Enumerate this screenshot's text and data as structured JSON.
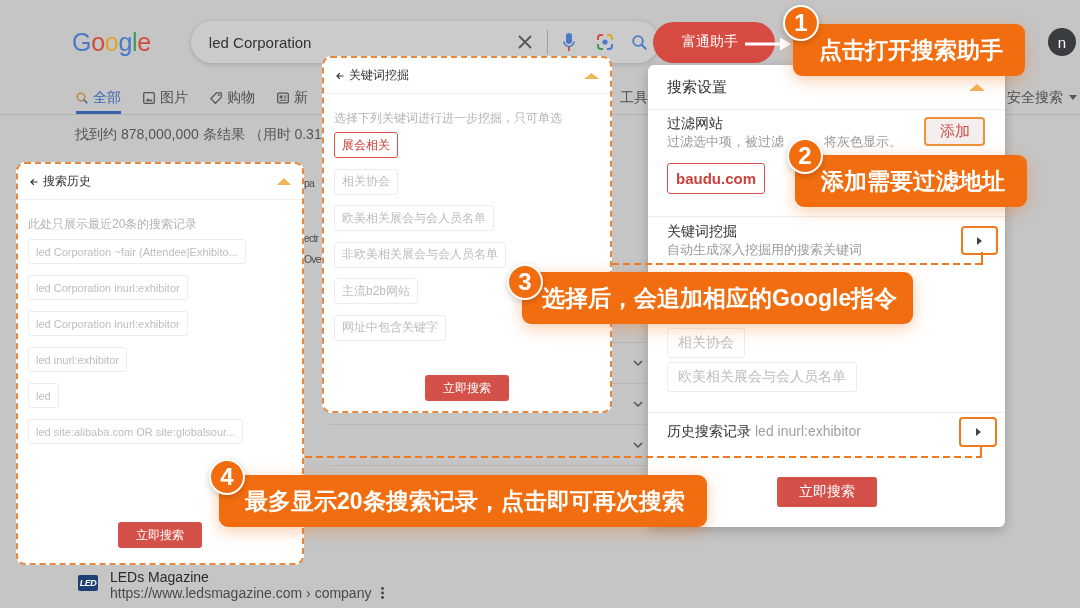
{
  "browser": {
    "logo": "Google",
    "query": "led Corporation",
    "assistant_button": "富通助手",
    "avatar": "n",
    "tabs": [
      {
        "label": "全部",
        "kind": "search",
        "selected": true
      },
      {
        "label": "图片",
        "kind": "image",
        "selected": false
      },
      {
        "label": "购物",
        "kind": "tag",
        "selected": false
      },
      {
        "label": "新",
        "kind": "news",
        "selected": false
      }
    ],
    "tools": "工具",
    "safe_search": "安全搜索",
    "result_stats": "找到约 878,000,000 条结果 （用时 0.31",
    "result_fragments": [
      "pa",
      "ectr",
      "Ove"
    ],
    "result": {
      "favicon": "LED",
      "title": "LEDs Magazine",
      "url": "https://www.ledsmagazine.com › company"
    }
  },
  "history_panel": {
    "title": "搜索历史",
    "hint": "此处只展示最近20条的搜索记录",
    "items": [
      "led Corporation ~fair (Attendee|Exhibito...",
      "led Corporation inurl:exhibitor",
      "led Corporation inurl:exhibitor",
      "led inurl:exhibitor",
      "led",
      "led site:alibaba.com OR site:globalsour..."
    ],
    "button": "立即搜索"
  },
  "keyword_panel": {
    "title": "关键词挖掘",
    "hint": "选择下列关键词进行进一步挖掘，只可单选",
    "options": [
      {
        "label": "展会相关",
        "selected": true
      },
      {
        "label": "相关协会",
        "selected": false
      },
      {
        "label": "欧美相关展会与会人员名单",
        "selected": false
      },
      {
        "label": "非欧美相关展会与会人员名单",
        "selected": false
      },
      {
        "label": "主流b2b网站",
        "selected": false
      },
      {
        "label": "网址中包含关键字",
        "selected": false
      }
    ],
    "button": "立即搜索"
  },
  "settings_panel": {
    "title": "搜索设置",
    "filter": {
      "title": "过滤网站",
      "description_parts": [
        "过滤选中项，被过滤",
        "将灰色显示。"
      ],
      "add_button": "添加",
      "sites": [
        "baudu.com"
      ]
    },
    "keyword_mining": {
      "title": "关键词挖掘",
      "description": "自动生成深入挖掘用的搜索关键词",
      "options": [
        {
          "label": "相关协会",
          "selected": false
        },
        {
          "label": "欧美相关展会与会人员名单",
          "selected": false
        }
      ]
    },
    "history": {
      "title": "历史搜索记录",
      "value": "led inurl:exhibitor"
    },
    "button": "立即搜索"
  },
  "callouts": [
    {
      "number": "1",
      "text": "点击打开搜索助手"
    },
    {
      "number": "2",
      "text": "添加需要过滤地址"
    },
    {
      "number": "3",
      "text": "选择后，会追加相应的Google指令"
    },
    {
      "number": "4",
      "text": "最多显示20条搜索记录，点击即可再次搜索"
    }
  ]
}
